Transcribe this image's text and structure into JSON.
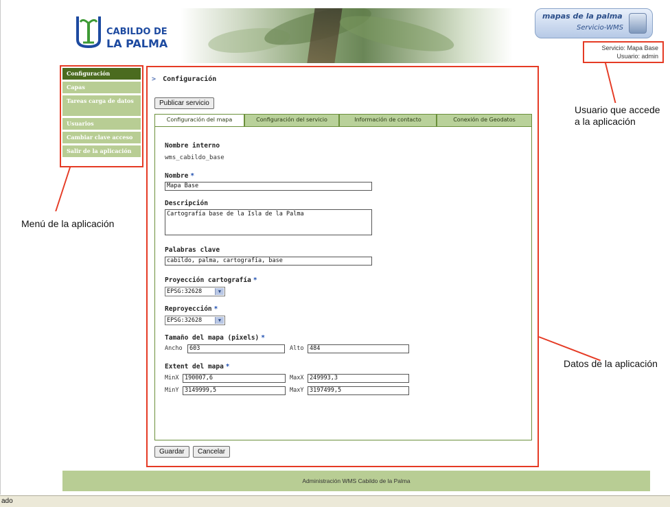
{
  "header": {
    "logo_line1": "CABILDO DE",
    "logo_line2": "LA PALMA",
    "wms_logo_title": "mapas de la palma",
    "wms_logo_subtitle": "Servicio-WMS",
    "service_line": "Servicio: Mapa Base",
    "user_line": "Usuario: admin"
  },
  "sidebar": {
    "items": [
      {
        "label": "Configuración",
        "active": true
      },
      {
        "label": "Capas"
      },
      {
        "label": "Tareas carga de datos"
      },
      {
        "label": "Usuarios"
      },
      {
        "label": "Cambiar clave acceso"
      },
      {
        "label": "Salir de la aplicación"
      }
    ]
  },
  "main": {
    "breadcrumb": "Configuración",
    "publish_button": "Publicar servicio",
    "tabs": [
      {
        "label": "Configuración del mapa",
        "active": true
      },
      {
        "label": "Configuración del servicio"
      },
      {
        "label": "Información de contacto"
      },
      {
        "label": "Conexión de Geodatos"
      }
    ],
    "form": {
      "internal_name_label": "Nombre interno",
      "internal_name_value": "wms_cabildo_base",
      "name_label": "Nombre",
      "name_value": "Mapa Base",
      "description_label": "Descripción",
      "description_value": "Cartografía base de la Isla de la Palma",
      "keywords_label": "Palabras clave",
      "keywords_value": "cabildo, palma, cartografía, base",
      "projection_label": "Proyección cartografía",
      "projection_value": "EPSG:32628",
      "reprojection_label": "Reproyección",
      "reprojection_value": "EPSG:32628",
      "map_size_label": "Tamaño del mapa (pixels)",
      "width_label": "Ancho",
      "width_value": "603",
      "height_label": "Alto",
      "height_value": "484",
      "extent_label": "Extent del mapa",
      "minx_label": "MinX",
      "minx_value": "190007,6",
      "maxx_label": "MaxX",
      "maxx_value": "249993,3",
      "miny_label": "MinY",
      "miny_value": "3149999,5",
      "maxy_label": "MaxY",
      "maxy_value": "3197499,5",
      "required_marker": "*"
    },
    "save_button": "Guardar",
    "cancel_button": "Cancelar"
  },
  "annotations": {
    "menu": "Menú de la aplicación",
    "user": "Usuario que accede\na la aplicación",
    "data": "Datos de la aplicación"
  },
  "footer": {
    "text": "Administración WMS Cabildo de la Palma"
  },
  "statusbar": {
    "text": "ado"
  },
  "colors": {
    "annotation_red": "#e53a24",
    "menu_green": "#b8cd94",
    "menu_active": "#4b6b1f",
    "brand_blue": "#1d4aa0"
  }
}
